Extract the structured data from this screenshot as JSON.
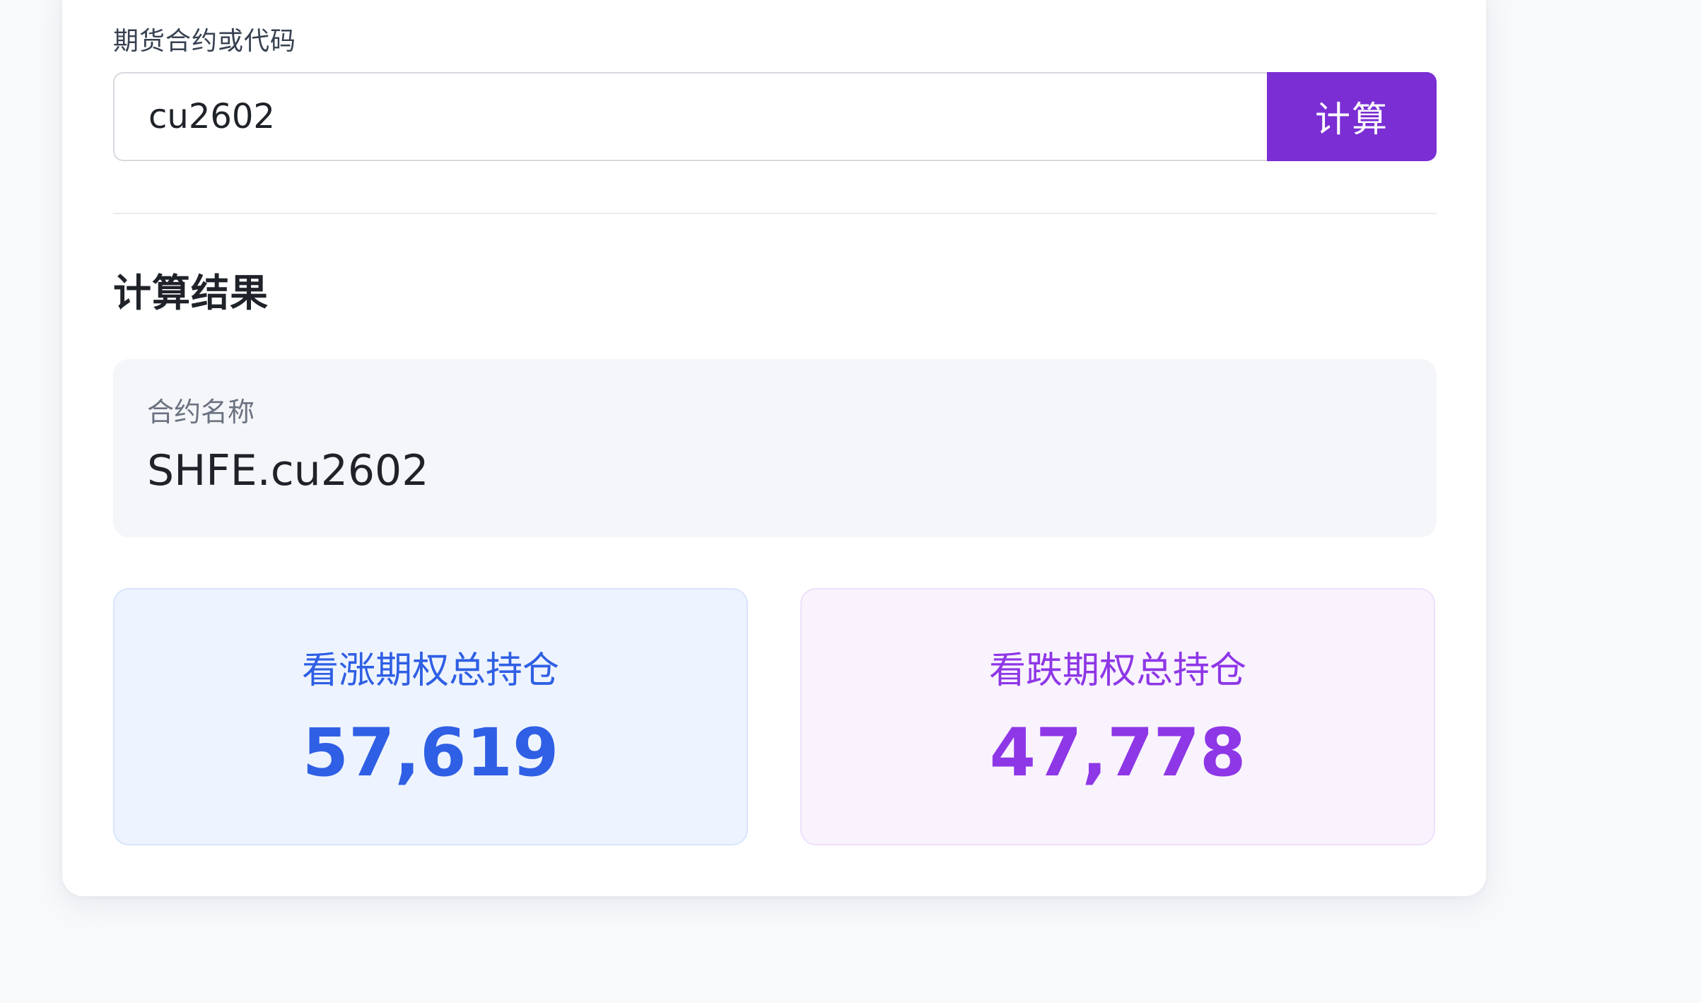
{
  "form": {
    "label": "期货合约或代码",
    "input_value": "cu2602",
    "button_label": "计算"
  },
  "results": {
    "title": "计算结果",
    "contract_name_label": "合约名称",
    "contract_name_value": "SHFE.cu2602",
    "call_oi_label": "看涨期权总持仓",
    "call_oi_value": "57,619",
    "put_oi_label": "看跌期权总持仓",
    "put_oi_value": "47,778"
  },
  "colors": {
    "accent": "#7a2ed3",
    "call": "#2f5fe4",
    "put": "#8e37e6"
  }
}
